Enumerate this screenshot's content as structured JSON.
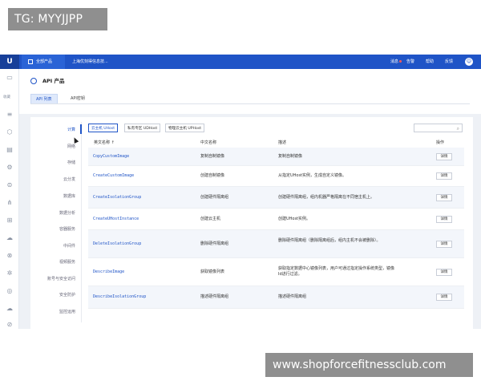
{
  "watermarks": {
    "top_left": "TG: MYYJJPP",
    "bottom_right": "www.shopforcefitnessclub.com"
  },
  "topbar": {
    "logo": "U",
    "all_products": "全部产品",
    "region": "上海优刻得信息技...",
    "right_items": {
      "messages": "消息",
      "alerts": "告警",
      "help": "帮助",
      "feedback": "反馈"
    },
    "user_initial": "☺"
  },
  "rail": {
    "favorites": "收藏"
  },
  "header": {
    "title": "API 产品",
    "tabs": [
      "API 列表",
      "API密钥"
    ]
  },
  "categories": [
    "计算",
    "网络",
    "存储",
    "云分发",
    "数据库",
    "数据分析",
    "容器服务",
    "中间件",
    "视频服务",
    "账号与安全访问",
    "安全防护",
    "监控运用"
  ],
  "segments": [
    "云主机 UHost",
    "私有专区 UDHost",
    "物理云主机 UPHost"
  ],
  "table": {
    "columns": [
      "英文名称 ↑",
      "中文名称",
      "描述",
      "操作"
    ],
    "action_label": "详情",
    "rows": [
      {
        "api": "CopyCustomImage",
        "cn": "复制自制镜像",
        "desc": "复制自制镜像"
      },
      {
        "api": "CreateCustomImage",
        "cn": "创建自制镜像",
        "desc": "从指定UHost实例，生成自定义镜像。"
      },
      {
        "api": "CreateIsolationGroup",
        "cn": "创建硬件隔离组",
        "desc": "创建硬件隔离组，组内机器严格隔离在不同宿主机上。"
      },
      {
        "api": "CreateUHostInstance",
        "cn": "创建云主机",
        "desc": "创建UHost实例。"
      },
      {
        "api": "DeleteIsolationGroup",
        "cn": "删除硬件隔离组",
        "desc": "删除硬件隔离组（删除隔离组后，组内主机不会被删除）。"
      },
      {
        "api": "DescribeImage",
        "cn": "获取镜像列表",
        "desc": "获取指定数据中心镜像列表，用户可通过指定操作系统类型，镜像Id进行过滤。"
      },
      {
        "api": "DescribeIsolationGroup",
        "cn": "描述硬件隔离组",
        "desc": "描述硬件隔离组"
      }
    ]
  },
  "colors": {
    "brand": "#1f54c7",
    "link": "#1f54c7"
  }
}
